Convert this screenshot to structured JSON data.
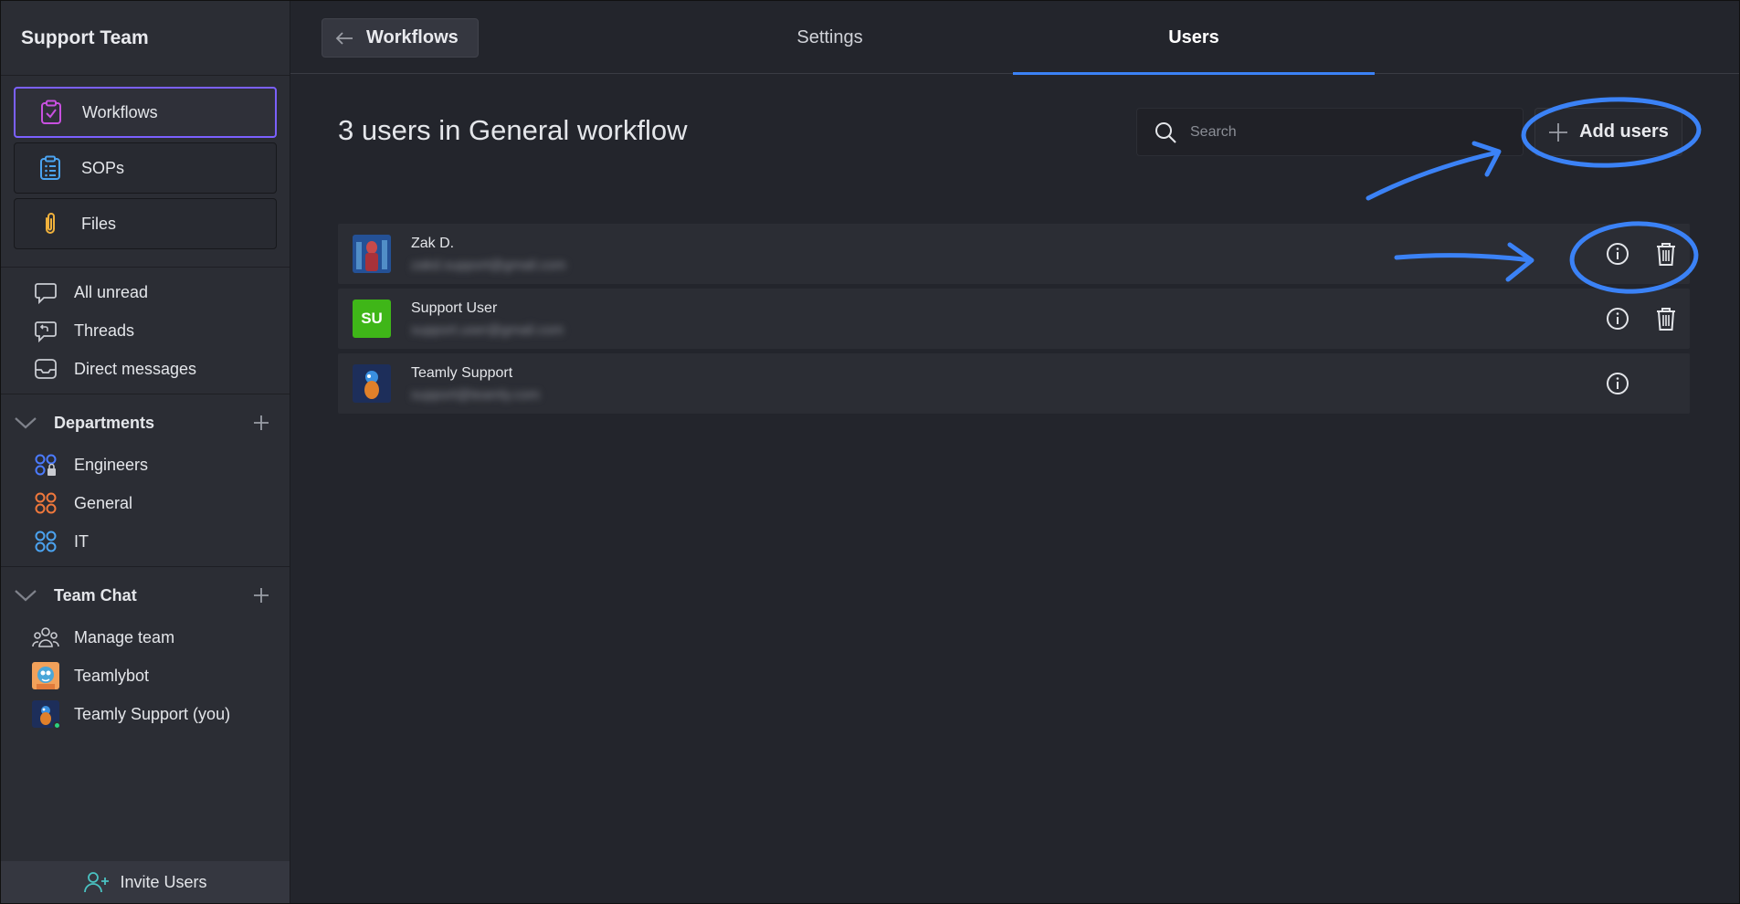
{
  "sidebar": {
    "team_name": "Support Team",
    "quick": [
      {
        "label": "Workflows",
        "icon": "clipboard-check-icon",
        "active": true
      },
      {
        "label": "SOPs",
        "icon": "clipboard-list-icon"
      },
      {
        "label": "Files",
        "icon": "paperclip-icon"
      }
    ],
    "nav": [
      {
        "label": "All unread",
        "icon": "chat-bubble-icon"
      },
      {
        "label": "Threads",
        "icon": "threads-icon"
      },
      {
        "label": "Direct messages",
        "icon": "inbox-icon"
      }
    ],
    "departments": {
      "title": "Departments",
      "items": [
        {
          "label": "Engineers",
          "icon": "group-lock-icon",
          "color": "#4b7bff"
        },
        {
          "label": "General",
          "icon": "group-icon",
          "color": "#f0783c"
        },
        {
          "label": "IT",
          "icon": "group-icon",
          "color": "#4ba3f0"
        }
      ]
    },
    "team_chat": {
      "title": "Team Chat",
      "items": [
        {
          "label": "Manage team",
          "icon": "team-icon"
        },
        {
          "label": "Teamlybot",
          "icon": "teamlybot-avatar"
        },
        {
          "label": "Teamly Support (you)",
          "icon": "teamly-support-avatar"
        }
      ]
    },
    "invite_label": "Invite Users"
  },
  "topbar": {
    "back_label": "Workflows",
    "tabs": [
      {
        "label": "Settings"
      },
      {
        "label": "Users",
        "active": true
      }
    ]
  },
  "main": {
    "heading": "3 users in General workflow",
    "search_placeholder": "Search",
    "add_users_label": "Add users",
    "users": [
      {
        "name": "Zak D.",
        "email": "zakd.support@gmail.com",
        "avatar_initials": "",
        "can_delete": true
      },
      {
        "name": "Support User",
        "email": "support.user@gmail.com",
        "avatar_initials": "SU",
        "avatar_color": "#3fb618",
        "can_delete": true
      },
      {
        "name": "Teamly Support",
        "email": "support@teamly.com",
        "avatar_initials": "",
        "can_delete": false
      }
    ]
  },
  "colors": {
    "accent": "#3b82f6",
    "active_border": "#7b60ff",
    "annotation": "#3b82f6"
  }
}
